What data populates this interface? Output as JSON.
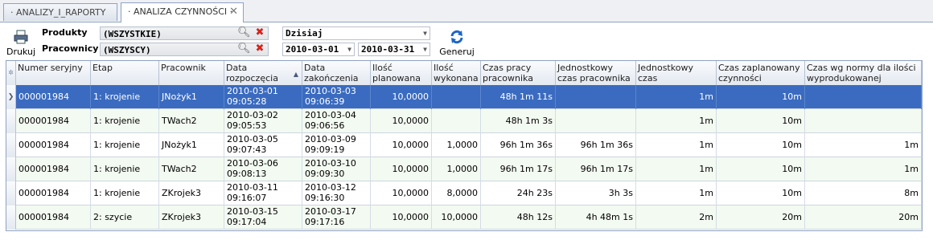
{
  "tabs": [
    {
      "label": "· ANALIZY_I_RAPORTY ·"
    },
    {
      "label": "· ANALIZA CZYNNOŚCI ·",
      "close": "✕"
    }
  ],
  "toolbar": {
    "print_label": "Drukuj",
    "products_label": "Produkty",
    "products_value": "(WSZYSTKIE)",
    "workers_label": "Pracownicy",
    "workers_value": "(WSZYSCY)",
    "period_value": "Dzisiaj",
    "date_from": "2010-03-01",
    "date_to": "2010-03-31",
    "generate_label": "Generuj"
  },
  "grid": {
    "columns": [
      "Numer seryjny",
      "Etap",
      "Pracownik",
      "Data rozpoczęcia",
      "Data zakończenia",
      "Ilość planowana",
      "Ilość wykonana",
      "Czas pracy pracownika",
      "Jednostkowy czas pracownika",
      "Jednostkowy czas zaplanowany",
      "Czas zaplanowany czynności",
      "Czas wg normy dla ilości wyprodukowanej"
    ],
    "rows": [
      [
        "000001984",
        "1: krojenie",
        "JNożyk1",
        "2010-03-01 09:05:28",
        "2010-03-03 09:06:39",
        "10,0000",
        "",
        "48h 1m 11s",
        "",
        "1m",
        "10m",
        ""
      ],
      [
        "000001984",
        "1: krojenie",
        "TWach2",
        "2010-03-02 09:05:53",
        "2010-03-04 09:06:56",
        "10,0000",
        "",
        "48h 1m 3s",
        "",
        "1m",
        "10m",
        ""
      ],
      [
        "000001984",
        "1: krojenie",
        "JNożyk1",
        "2010-03-05 09:07:43",
        "2010-03-09 09:09:19",
        "10,0000",
        "1,0000",
        "96h 1m 36s",
        "96h 1m 36s",
        "1m",
        "10m",
        "1m"
      ],
      [
        "000001984",
        "1: krojenie",
        "TWach2",
        "2010-03-06 09:08:13",
        "2010-03-10 09:09:30",
        "10,0000",
        "1,0000",
        "96h 1m 17s",
        "96h 1m 17s",
        "1m",
        "10m",
        "1m"
      ],
      [
        "000001984",
        "1: krojenie",
        "ZKrojek3",
        "2010-03-11 09:16:07",
        "2010-03-12 09:16:30",
        "10,0000",
        "8,0000",
        "24h 23s",
        "3h 3s",
        "1m",
        "10m",
        "8m"
      ],
      [
        "000001984",
        "2: szycie",
        "ZKrojek3",
        "2010-03-15 09:17:04",
        "2010-03-17 09:17:16",
        "10,0000",
        "10,0000",
        "48h 12s",
        "4h 48m 1s",
        "2m",
        "20m",
        "20m"
      ]
    ]
  }
}
